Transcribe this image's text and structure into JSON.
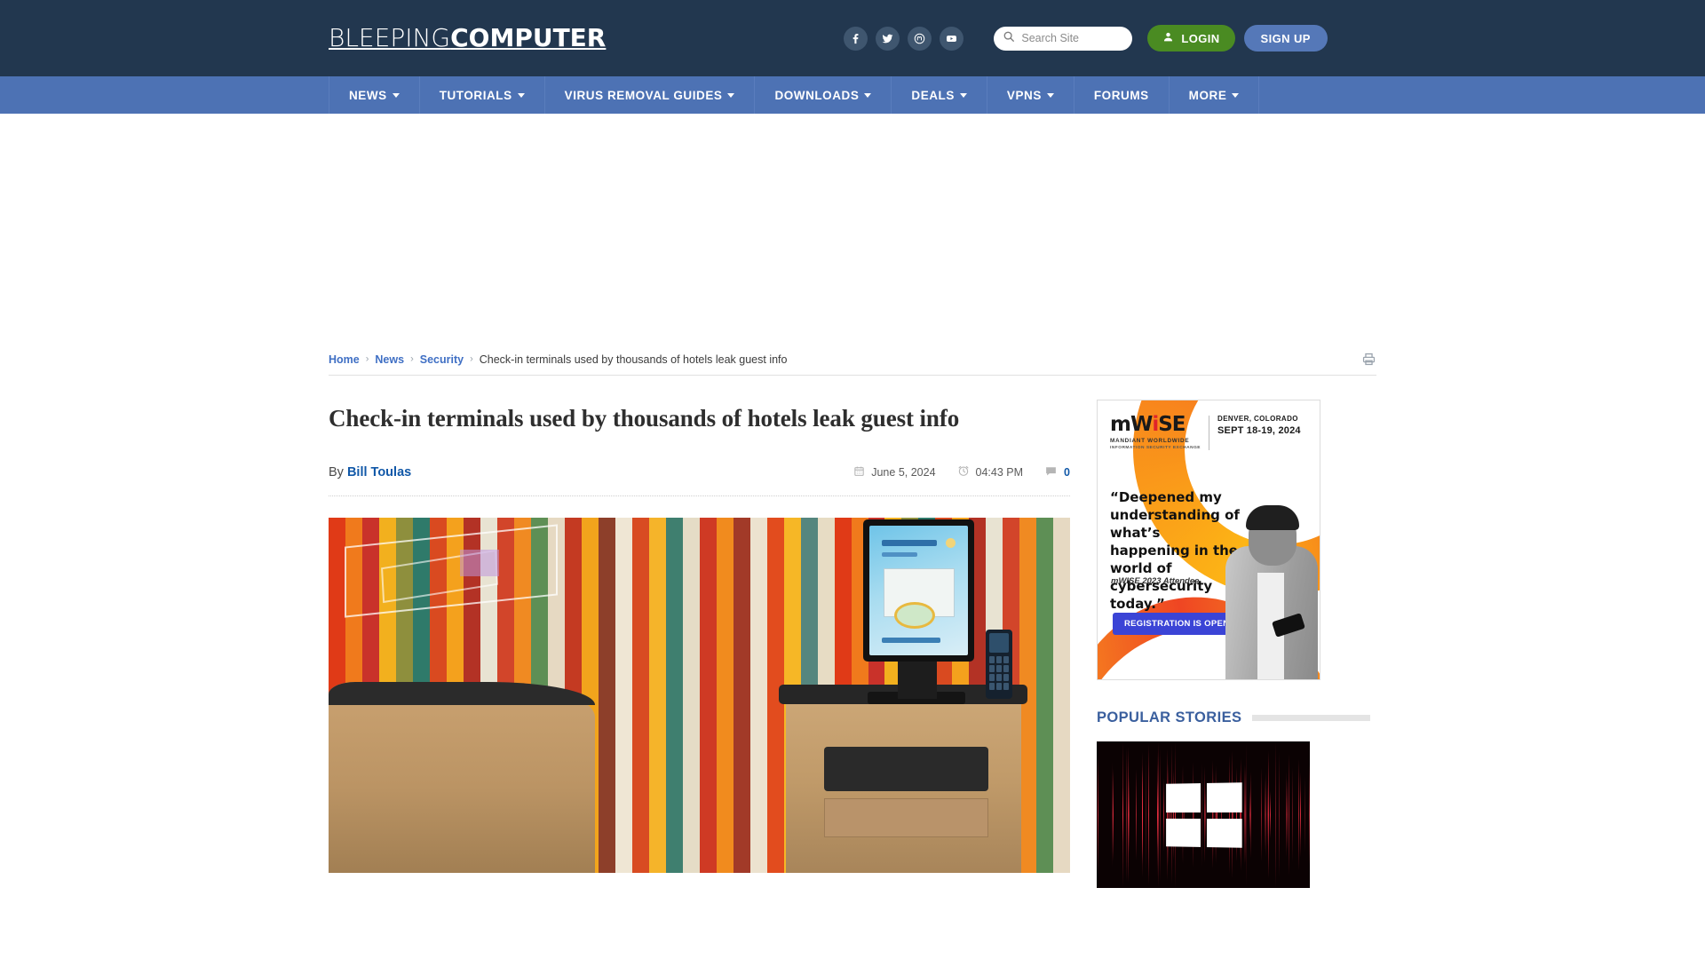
{
  "site": {
    "logo_light": "BLEEPING",
    "logo_bold": "COMPUTER"
  },
  "header": {
    "social": [
      {
        "name": "facebook-icon",
        "label": "Facebook"
      },
      {
        "name": "twitter-icon",
        "label": "Twitter"
      },
      {
        "name": "mastodon-icon",
        "label": "Mastodon"
      },
      {
        "name": "youtube-icon",
        "label": "YouTube"
      }
    ],
    "search": {
      "placeholder": "Search Site",
      "value": ""
    },
    "login_label": "LOGIN",
    "signup_label": "SIGN UP"
  },
  "nav": {
    "items": [
      {
        "label": "NEWS",
        "has_caret": true
      },
      {
        "label": "TUTORIALS",
        "has_caret": true
      },
      {
        "label": "VIRUS REMOVAL GUIDES",
        "has_caret": true
      },
      {
        "label": "DOWNLOADS",
        "has_caret": true
      },
      {
        "label": "DEALS",
        "has_caret": true
      },
      {
        "label": "VPNS",
        "has_caret": true
      },
      {
        "label": "FORUMS",
        "has_caret": false
      },
      {
        "label": "MORE",
        "has_caret": true
      }
    ]
  },
  "breadcrumb": {
    "items": [
      {
        "label": "Home",
        "link": true
      },
      {
        "label": "News",
        "link": true
      },
      {
        "label": "Security",
        "link": true
      },
      {
        "label": "Check-in terminals used by thousands of hotels leak guest info",
        "link": false
      }
    ],
    "separator": "›"
  },
  "article": {
    "title": "Check-in terminals used by thousands of hotels leak guest info",
    "by_prefix": "By",
    "author": "Bill Toulas",
    "date": "June 5, 2024",
    "time": "04:43 PM",
    "comment_count": "0",
    "image_alt": "Hotel self check-in kiosk terminal in front of a colorful striped wall"
  },
  "sidebar": {
    "ad": {
      "brand": "mWISE",
      "brand_pre": "mW",
      "brand_i": "i",
      "brand_post": "SE",
      "sub_line1": "MANDIANT WORLDWIDE",
      "sub_line2": "INFORMATION SECURITY EXCHANGE",
      "location": "DENVER, COLORADO",
      "dates": "SEPT 18-19, 2024",
      "quote": "“Deepened my understanding of what’s happening in the world of cybersecurity today.”",
      "attribution": "mWISE 2023 Attendee",
      "cta_label": "REGISTRATION IS OPEN"
    },
    "popular": {
      "heading": "POPULAR STORIES",
      "thumb_alt": "Windows logo over red digital rain background"
    }
  },
  "colors": {
    "header_bg": "#22374f",
    "nav_bg": "#4d72b4",
    "login_green": "#4a8b22",
    "signup_blue": "#5578b8",
    "link_blue": "#3f6fc4",
    "author_blue": "#1158a8",
    "popular_heading": "#3a5f9e",
    "ad_cta": "#3b44d6",
    "ad_orange": "#f7941e",
    "ad_red": "#ef4623"
  }
}
